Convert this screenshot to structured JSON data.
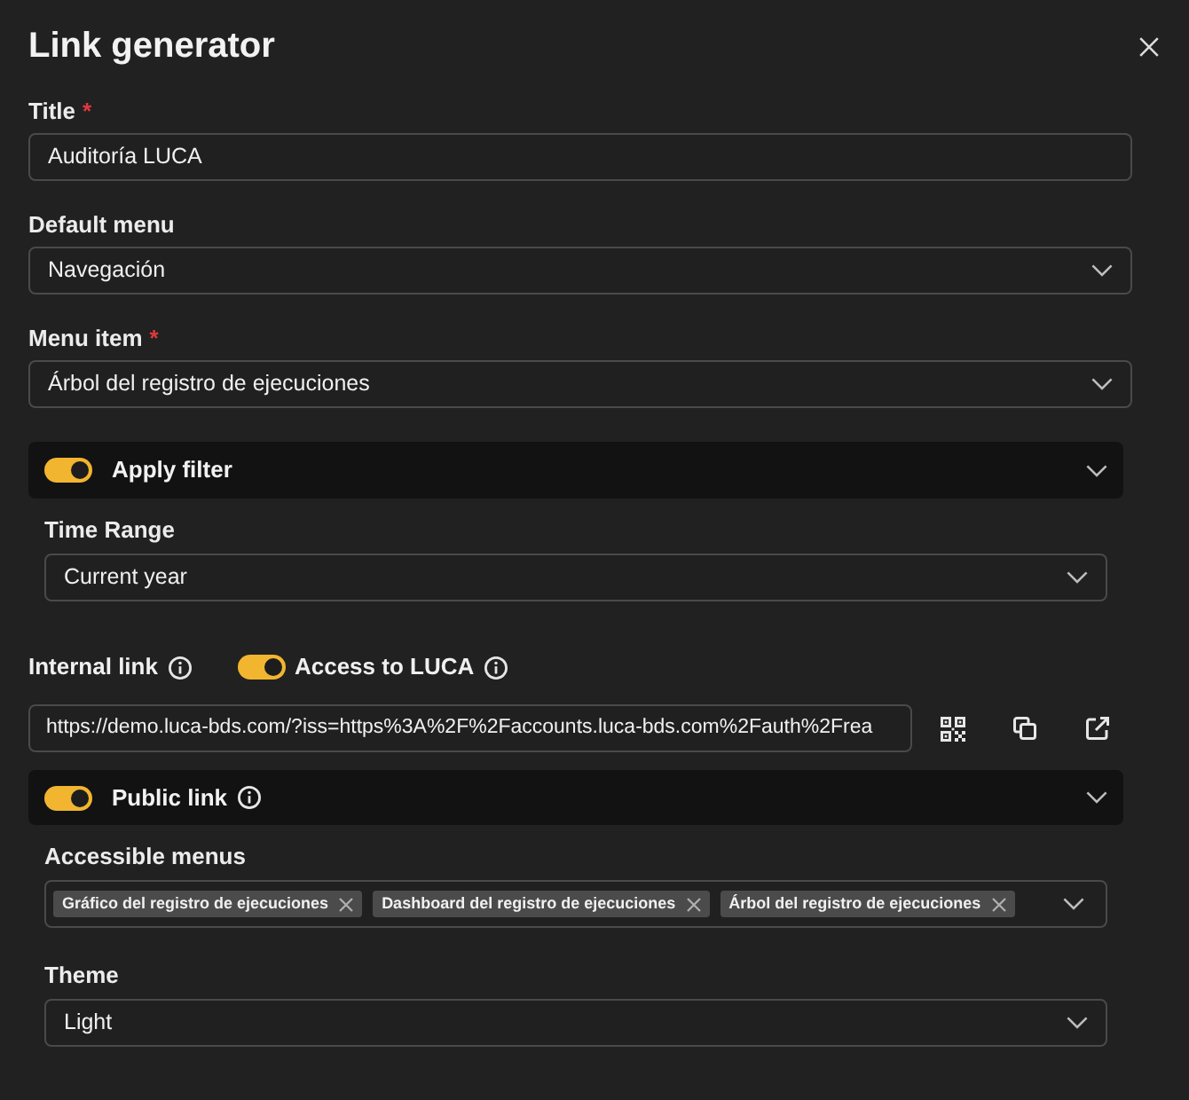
{
  "dialog": {
    "title": "Link generator"
  },
  "fields": [
    {
      "kind": "text",
      "label": "Title",
      "required_mark": "*",
      "value": "Auditoría LUCA"
    },
    {
      "kind": "select",
      "label": "Default menu",
      "value": "Navegación"
    },
    {
      "kind": "select",
      "label": "Menu item",
      "required_mark": "*",
      "value": "Árbol del registro de ejecuciones"
    }
  ],
  "apply_filter": {
    "label": "Apply filter",
    "on": true,
    "expanded": true,
    "fields": [
      {
        "kind": "select",
        "label": "Time Range",
        "value": "Current year"
      }
    ]
  },
  "internal_link": {
    "label": "Internal link",
    "access": {
      "label": "Access to LUCA",
      "on": true
    },
    "url": "https://demo.luca-bds.com/?iss=https%3A%2F%2Faccounts.luca-bds.com%2Fauth%2Frea"
  },
  "public_link": {
    "label": "Public link",
    "on": true,
    "expanded": true,
    "fields": [
      {
        "kind": "multiselect",
        "label": "Accessible menus",
        "tags": [
          "Gráfico del registro de ejecuciones",
          "Dashboard del registro de ejecuciones",
          "Árbol del registro de ejecuciones"
        ]
      },
      {
        "kind": "select",
        "label": "Theme",
        "value": "Light"
      }
    ]
  }
}
